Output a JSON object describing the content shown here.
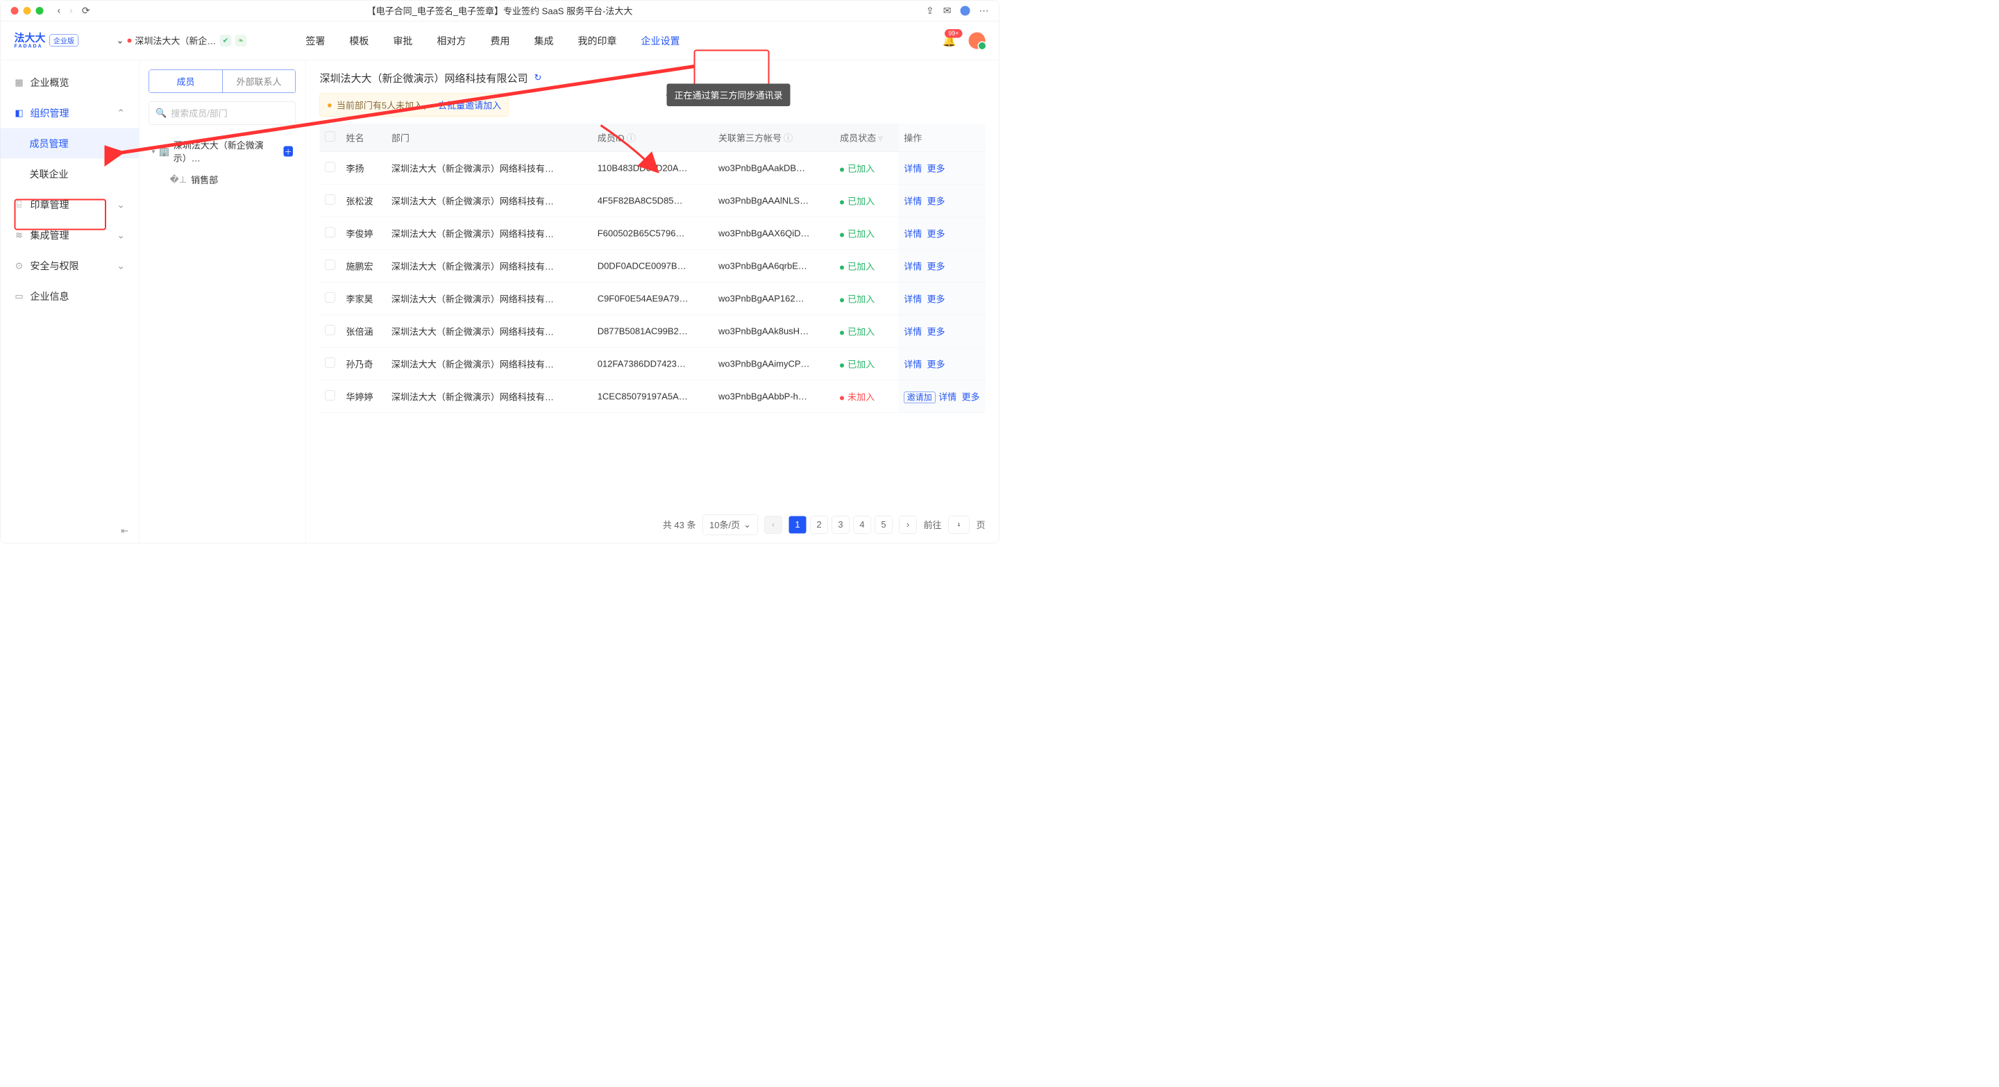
{
  "window_title": "【电子合同_电子签名_电子签章】专业签约 SaaS 服务平台-法大大",
  "brand": {
    "name": "法大大",
    "sub": "FADADA",
    "edition": "企业版"
  },
  "org_selector": {
    "name": "深圳法大大（新企…"
  },
  "main_nav": [
    "签署",
    "模板",
    "审批",
    "相对方",
    "费用",
    "集成",
    "我的印章",
    "企业设置"
  ],
  "notif_count": "99+",
  "sidebar": {
    "items": [
      {
        "icon": "▦",
        "label": "企业概览"
      },
      {
        "icon": "◧",
        "label": "组织管理",
        "expand": true
      },
      {
        "label": "成员管理",
        "sub": true,
        "active": true
      },
      {
        "label": "关联企业",
        "sub": true
      },
      {
        "icon": "⌸",
        "label": "印章管理",
        "chev": true
      },
      {
        "icon": "≋",
        "label": "集成管理",
        "chev": true
      },
      {
        "icon": "⊙",
        "label": "安全与权限",
        "chev": true
      },
      {
        "icon": "▭",
        "label": "企业信息"
      }
    ]
  },
  "dept": {
    "tabs": [
      "成员",
      "外部联系人"
    ],
    "search_ph": "搜索成员/部门",
    "root": "深圳法大大（新企微演示）…",
    "child": "销售部"
  },
  "content": {
    "title": "深圳法大大（新企微演示）网络科技有限公司",
    "notice_pre": "当前部门有5人未加入，",
    "notice_link": "去批量邀请加入",
    "tooltip": "正在通过第三方同步通讯录"
  },
  "table": {
    "headers": [
      "",
      "姓名",
      "部门",
      "成员ID",
      "关联第三方帐号",
      "成员状态",
      "操作"
    ],
    "id_info": "ⓘ",
    "third_info": "ⓘ",
    "status_filter": "▿",
    "ops": {
      "detail": "详情",
      "more": "更多",
      "invite": "邀请加"
    },
    "rows": [
      {
        "name": "李扬",
        "dept": "深圳法大大（新企微演示）网络科技有…",
        "mid": "110B483DD63D20A…",
        "third": "wo3PnbBgAAakDB…",
        "joined": true
      },
      {
        "name": "张松波",
        "dept": "深圳法大大（新企微演示）网络科技有…",
        "mid": "4F5F82BA8C5D85…",
        "third": "wo3PnbBgAAAlNLS…",
        "joined": true
      },
      {
        "name": "李俊婷",
        "dept": "深圳法大大（新企微演示）网络科技有…",
        "mid": "F600502B65C5796…",
        "third": "wo3PnbBgAAX6QiD…",
        "joined": true
      },
      {
        "name": "施鹏宏",
        "dept": "深圳法大大（新企微演示）网络科技有…",
        "mid": "D0DF0ADCE0097B…",
        "third": "wo3PnbBgAA6qrbE…",
        "joined": true
      },
      {
        "name": "李家昊",
        "dept": "深圳法大大（新企微演示）网络科技有…",
        "mid": "C9F0F0E54AE9A79…",
        "third": "wo3PnbBgAAP162…",
        "joined": true
      },
      {
        "name": "张倍涵",
        "dept": "深圳法大大（新企微演示）网络科技有…",
        "mid": "D877B5081AC99B2…",
        "third": "wo3PnbBgAAk8usH…",
        "joined": true
      },
      {
        "name": "孙乃奇",
        "dept": "深圳法大大（新企微演示）网络科技有…",
        "mid": "012FA7386DD7423…",
        "third": "wo3PnbBgAAimyCP…",
        "joined": true
      },
      {
        "name": "华婷婷",
        "dept": "深圳法大大（新企微演示）网络科技有…",
        "mid": "1CEC85079197A5A…",
        "third": "wo3PnbBgAAbbP-h…",
        "joined": false
      }
    ],
    "status_joined": "已加入",
    "status_no": "未加入"
  },
  "pager": {
    "total": "共 43 条",
    "size": "10条/页",
    "pages": [
      "1",
      "2",
      "3",
      "4",
      "5"
    ],
    "goto_pre": "前往",
    "goto_val": "1",
    "goto_suf": "页"
  }
}
